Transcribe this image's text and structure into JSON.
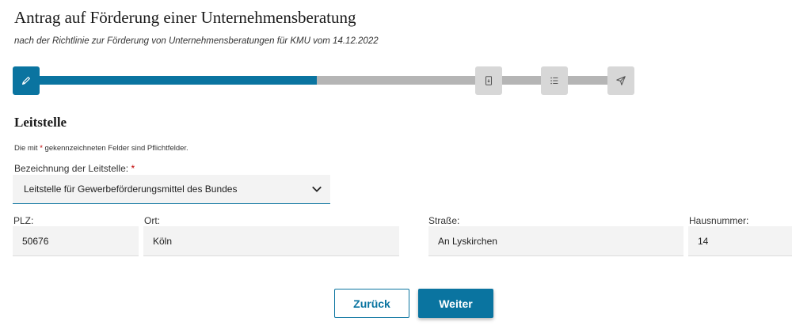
{
  "header": {
    "title": "Antrag auf Förderung einer Unternehmensberatung",
    "subtitle": "nach der Richtlinie zur Förderung von Unternehmensberatungen für KMU vom 14.12.2022"
  },
  "stepper": {
    "progress_percent": 45,
    "steps": [
      {
        "icon": "pencil-icon",
        "state": "active"
      },
      {
        "icon": "document-icon",
        "state": "inactive"
      },
      {
        "icon": "list-icon",
        "state": "inactive"
      },
      {
        "icon": "send-icon",
        "state": "inactive"
      }
    ]
  },
  "section": {
    "title": "Leitstelle",
    "required_note_prefix": "Die mit ",
    "required_star": "*",
    "required_note_suffix": " gekennzeichneten Felder sind Pflichtfelder."
  },
  "form": {
    "leitstelle": {
      "label": "Bezeichnung der Leitstelle:",
      "required_star": "*",
      "value": "Leitstelle für Gewerbeförderungsmittel des Bundes"
    },
    "plz": {
      "label": "PLZ:",
      "value": "50676"
    },
    "ort": {
      "label": "Ort:",
      "value": "Köln"
    },
    "strasse": {
      "label": "Straße:",
      "value": "An Lyskirchen"
    },
    "hausnummer": {
      "label": "Hausnummer:",
      "value": "14"
    }
  },
  "buttons": {
    "back": "Zurück",
    "next": "Weiter"
  },
  "colors": {
    "primary": "#0a74a0",
    "inactive": "#b5b5b5",
    "required": "#c00000"
  }
}
